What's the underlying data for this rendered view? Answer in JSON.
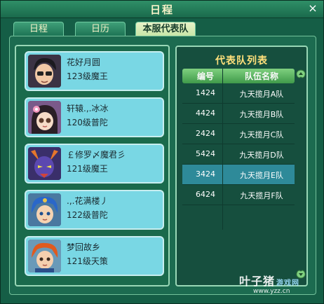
{
  "window": {
    "title": "日程",
    "close_label": "×"
  },
  "tabs": [
    {
      "label": "日程",
      "active": false
    },
    {
      "label": "日历",
      "active": false
    },
    {
      "label": "本服代表队",
      "active": true
    }
  ],
  "players": [
    {
      "name": "花好月圆",
      "info": "123级魔王",
      "avatar_icon": "male-sunglasses-avatar-icon"
    },
    {
      "name": "轩辕.,.冰冰",
      "info": "120级普陀",
      "avatar_icon": "female-flower-avatar-icon"
    },
    {
      "name": "￡修罗〆魔君彡",
      "info": "121级魔王",
      "avatar_icon": "demon-avatar-icon"
    },
    {
      "name": ".,.花满楼丿",
      "info": "122级普陀",
      "avatar_icon": "blue-hair-avatar-icon"
    },
    {
      "name": "梦回故乡",
      "info": "121级天策",
      "avatar_icon": "red-hair-avatar-icon"
    }
  ],
  "team_list": {
    "title": "代表队列表",
    "headers": {
      "id": "编号",
      "name": "队伍名称"
    },
    "rows": [
      {
        "id": "1424",
        "name": "九天揽月A队",
        "selected": false
      },
      {
        "id": "4424",
        "name": "九天揽月B队",
        "selected": false
      },
      {
        "id": "2424",
        "name": "九天揽月C队",
        "selected": false
      },
      {
        "id": "5424",
        "name": "九天揽月D队",
        "selected": false
      },
      {
        "id": "3424",
        "name": "九天揽月E队",
        "selected": true
      },
      {
        "id": "6424",
        "name": "九天揽月F队",
        "selected": false
      }
    ]
  },
  "watermark": {
    "main": "叶子猪",
    "sub": "游戏网",
    "url": "www.yzz.cn"
  },
  "colors": {
    "accent": "#79d7e4",
    "title_text": "#ffe07b",
    "panel": "#1a6a4c"
  }
}
